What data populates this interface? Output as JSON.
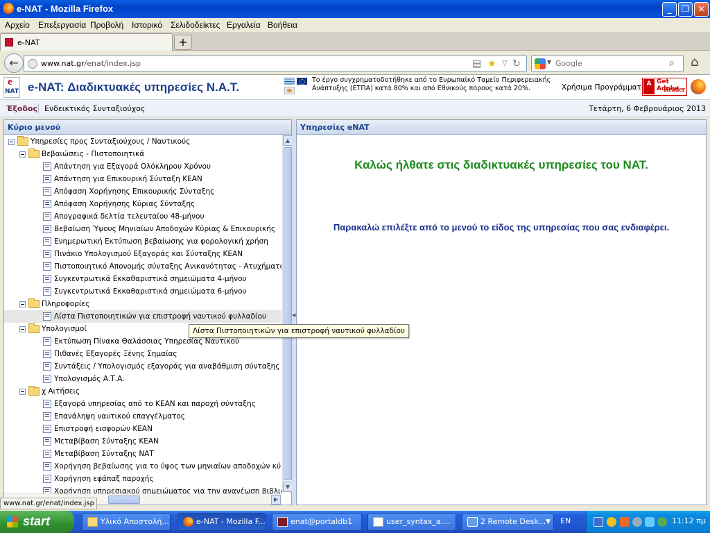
{
  "window": {
    "title": "e-NAT - Mozilla Firefox",
    "minimize": "_",
    "maximize": "❐",
    "close": "✕"
  },
  "menu": [
    "Αρχείο",
    "Επεξεργασία",
    "Προβολή",
    "Ιστορικό",
    "Σελιδοδείκτες",
    "Εργαλεία",
    "Βοήθεια"
  ],
  "tab": {
    "label": "e-NAT",
    "new_tab": "+"
  },
  "nav": {
    "url_host": "www.nat.gr",
    "url_path": "/enat/index.jsp",
    "search_placeholder": "Google"
  },
  "header": {
    "logo_e": "e",
    "logo_nat": "NAT",
    "title": "e-NAT: Διαδικτυακές υπηρεσίες Ν.Α.Τ.",
    "eu_text": "Το έργο συγχρηματοδοτήθηκε από το Ευρωπαϊκό Ταμείο Περιφερειακής Ανάπτυξης (ΕΤΠΑ) κατά 80% και από Εθνικούς πόρους κατά 20%.",
    "useful_programs": "Χρήσιμα Προγράμματα:",
    "adobe_a": "Adobe",
    "adobe_get": "Get Adobe",
    "adobe_reader": "Reader"
  },
  "subbar": {
    "exit": "Έξοδος",
    "indicative": "Ενδεικτικός Συνταξιούχος",
    "date": "Τετάρτη, 6 Φεβρουάριος 2013"
  },
  "left_panel": {
    "title": "Κύριο μενού",
    "tree": [
      {
        "label": "Υπηρεσίες προς Συνταξιούχους / Ναυτικούς",
        "type": "folder",
        "level": 0
      },
      {
        "label": "Βεβαιώσεις - Πιστοποιητικά",
        "type": "folder",
        "level": 1
      },
      {
        "label": "Απάντηση για Εξαγορά Ολόκληρου Χρόνου",
        "type": "leaf",
        "level": 2
      },
      {
        "label": "Απάντηση για Επικουρική Σύνταξη ΚΕΑΝ",
        "type": "leaf",
        "level": 2
      },
      {
        "label": "Απόφαση Χορήγησης Επικουρικής Σύνταξης",
        "type": "leaf",
        "level": 2
      },
      {
        "label": "Απόφαση Χορήγησης Κύριας Σύνταξης",
        "type": "leaf",
        "level": 2
      },
      {
        "label": "Απογραφικά δελτία τελευταίου 48-μήνου",
        "type": "leaf",
        "level": 2
      },
      {
        "label": "Βεβαίωση Ύψους Μηνιαίων Αποδοχών Κύριας & Επικουρικής",
        "type": "leaf",
        "level": 2
      },
      {
        "label": "Ενημερωτική Εκτύπωση βεβαίωσης για φορολογική χρήση",
        "type": "leaf",
        "level": 2
      },
      {
        "label": "Πινάκιο Υπολογισμού Εξαγοράς και Σύνταξης ΚΕΑΝ",
        "type": "leaf",
        "level": 2
      },
      {
        "label": "Πιστοποιητικό Απονομής σύνταξης Ανικανότητας - Ατυχήματος - Γήρ",
        "type": "leaf",
        "level": 2
      },
      {
        "label": "Συγκεντρωτικά Εκκαθαριστικά σημειώματα 4-μήνου",
        "type": "leaf",
        "level": 2
      },
      {
        "label": "Συγκεντρωτικά Εκκαθαριστικά σημειώματα 6-μήνου",
        "type": "leaf",
        "level": 2
      },
      {
        "label": "Πληροφορίες",
        "type": "folder",
        "level": 1
      },
      {
        "label": "Λίστα Πιστοποιητικών για επιστροφή ναυτικού φυλλαδίου",
        "type": "leaf",
        "level": 2,
        "selected": true
      },
      {
        "label": "Υπολογισμοί",
        "type": "folder",
        "level": 1
      },
      {
        "label": "Εκτύπωση Πίνακα Θαλάσσιας Υπηρεσίας Ναυτικού",
        "type": "leaf",
        "level": 2
      },
      {
        "label": "Πιθανές Εξαγορές Ξένης Σημαίας",
        "type": "leaf",
        "level": 2
      },
      {
        "label": "Συντάξεις / Υπολογισμός εξαγοράς για αναβάθμιση σύνταξης",
        "type": "leaf",
        "level": 2
      },
      {
        "label": "Υπολογισμός Α.Τ.Α.",
        "type": "leaf",
        "level": 2
      },
      {
        "label": "χ Αιτήσεις",
        "type": "folder",
        "level": 1
      },
      {
        "label": "Εξαγορά υπηρεσίας από το ΚΕΑΝ και παροχή σύνταξης",
        "type": "leaf",
        "level": 2
      },
      {
        "label": "Επανάληψη ναυτικού επαγγέλματος",
        "type": "leaf",
        "level": 2
      },
      {
        "label": "Επιστροφή εισφορών ΚΕΑΝ",
        "type": "leaf",
        "level": 2
      },
      {
        "label": "Μεταβίβαση Σύνταξης ΚΕΑΝ",
        "type": "leaf",
        "level": 2
      },
      {
        "label": "Μεταβίβαση Σύνταξης ΝΑΤ",
        "type": "leaf",
        "level": 2
      },
      {
        "label": "Χορήγηση βεβαίωσης για το ύψος των μηνιαίων αποδοχών κύριας και",
        "type": "leaf",
        "level": 2
      },
      {
        "label": "Χορήγηση εφάπαξ παροχής",
        "type": "leaf",
        "level": 2
      },
      {
        "label": "Χορήγηση υπηρεσιακού σημειώματος για την ανανέωση βιβλιαρίου υ",
        "type": "leaf",
        "level": 2
      }
    ]
  },
  "right_panel": {
    "title": "Υπηρεσίες eNAT",
    "welcome": "Καλώς ήλθατε στις διαδικτυακές υπηρεσίες του ΝΑΤ.",
    "instruction": "Παρακαλώ επιλέξτε από το μενού το είδος της υπηρεσίας που σας ενδιαφέρει."
  },
  "tooltip": "Λίστα Πιστοποιητικών για επιστροφή ναυτικού φυλλαδίου",
  "status": "www.nat.gr/enat/index.jsp",
  "taskbar": {
    "start": "start",
    "tasks": [
      {
        "label": "Υλικό Αποστολή...",
        "icon": "folder"
      },
      {
        "label": "e-NAT - Mozilla F...",
        "icon": "ff",
        "active": true
      },
      {
        "label": "enat@portaldb1",
        "icon": "term"
      },
      {
        "label": "user_syntax_a....",
        "icon": "doc"
      },
      {
        "label": "2 Remote Desk...",
        "icon": "rd"
      }
    ],
    "lang": "EN",
    "clock": "11:12 πμ"
  }
}
